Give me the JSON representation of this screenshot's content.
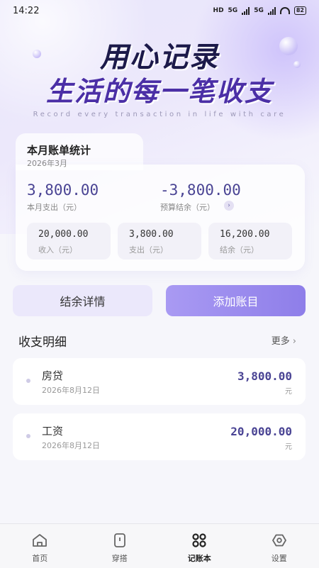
{
  "status_bar": {
    "time": "14:22",
    "network1": "HD",
    "network2": "5G",
    "network3": "5G",
    "battery": "82"
  },
  "hero": {
    "slogan_line1": "用心记录",
    "slogan_line2": "生活的每一笔收支",
    "slogan_en": "Record every transaction in life with care"
  },
  "stats": {
    "title": "本月账单统计",
    "date": "2026年3月",
    "month_expense": {
      "value": "3,800.00",
      "label": "本月支出（元）"
    },
    "budget_balance": {
      "value": "-3,800.00",
      "label": "预算结余（元）"
    },
    "income": {
      "value": "20,000.00",
      "label": "收入（元）"
    },
    "expense": {
      "value": "3,800.00",
      "label": "支出（元）"
    },
    "balance": {
      "value": "16,200.00",
      "label": "结余（元）"
    }
  },
  "actions": {
    "detail_label": "结余详情",
    "add_label": "添加账目"
  },
  "transactions": {
    "title": "收支明细",
    "more": "更多",
    "items": [
      {
        "name": "房贷",
        "date": "2026年8月12日",
        "amount": "3,800.00",
        "unit": "元"
      },
      {
        "name": "工资",
        "date": "2026年8月12日",
        "amount": "20,000.00",
        "unit": "元"
      }
    ]
  },
  "tabbar": {
    "items": [
      {
        "label": "首页",
        "icon": "home-icon"
      },
      {
        "label": "穿搭",
        "icon": "wardrobe-icon"
      },
      {
        "label": "记账本",
        "icon": "ledger-icon",
        "active": true
      },
      {
        "label": "设置",
        "icon": "settings-icon"
      }
    ]
  },
  "colors": {
    "accent": "#8e7ee9",
    "accent_light": "#ebe8fb",
    "amount": "#4a4494"
  }
}
